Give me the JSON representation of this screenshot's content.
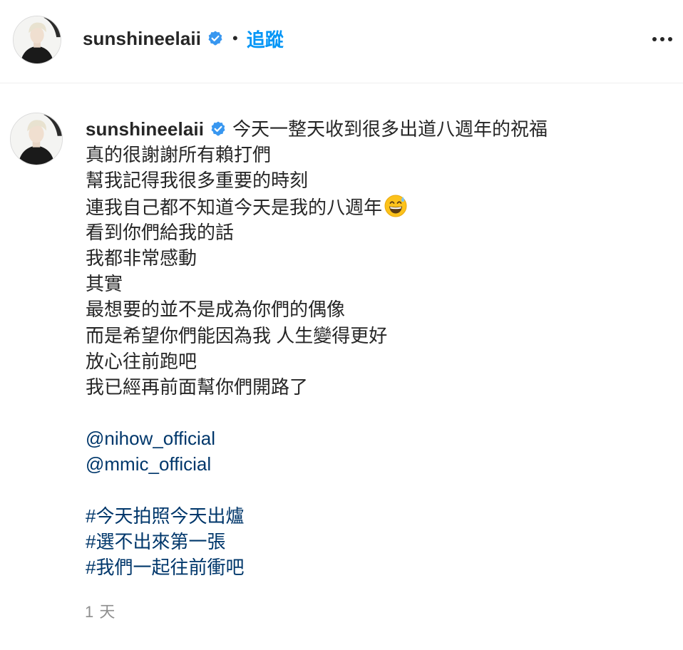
{
  "header": {
    "username": "sunshineelaii",
    "separator": "•",
    "follow_label": "追蹤",
    "more_icon": "more-horizontal-icon"
  },
  "caption": {
    "username": "sunshineelaii",
    "first_line_text": "今天一整天收到很多出道八週年的祝福",
    "lines": [
      "真的很謝謝所有賴打們",
      "幫我記得我很多重要的時刻",
      "連我自己都不知道今天是我的八週年",
      "看到你們給我的話",
      "我都非常感動",
      "其實",
      "最想要的並不是成為你們的偶像",
      "而是希望你們能因為我 人生變得更好",
      "放心往前跑吧",
      "我已經再前面幫你們開路了"
    ],
    "emoji": "grinning-face-with-sweat-emoji",
    "mentions": [
      "@nihow_official",
      "@mmic_official"
    ],
    "hashtags": [
      "#今天拍照今天出爐",
      "#選不出來第一張",
      "#我們一起往前衝吧"
    ]
  },
  "timestamp": "1 天",
  "colors": {
    "text": "#262626",
    "follow_blue": "#0095f6",
    "link_navy": "#00376b",
    "verified_blue": "#3897f0",
    "muted": "#8e8e8e"
  }
}
